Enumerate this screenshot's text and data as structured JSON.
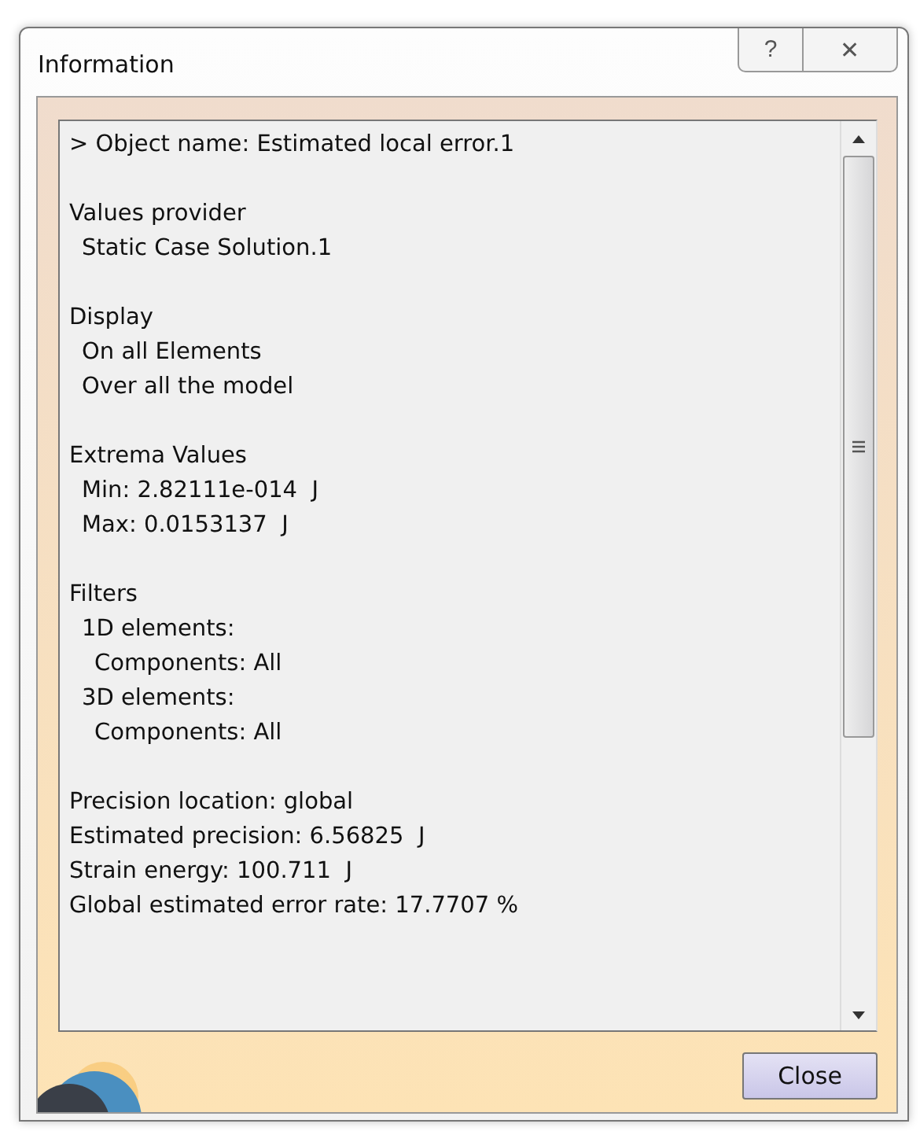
{
  "window": {
    "title": "Information",
    "title_buttons": [
      "?",
      "✕"
    ]
  },
  "groups": [
    [
      {
        "text": "> Object name: Estimated local error.1"
      }
    ],
    [
      {
        "text": "Values provider",
        "children": [
          {
            "text": "Static Case Solution.1"
          }
        ]
      }
    ],
    [
      {
        "text": "Display",
        "children": [
          {
            "text": "On all Elements"
          },
          {
            "text": "Over all the model"
          }
        ]
      }
    ],
    [
      {
        "text": "Extrema Values",
        "children": [
          {
            "text": "Min: 2.82111e-014  J"
          },
          {
            "text": "Max: 0.0153137  J"
          }
        ]
      }
    ],
    [
      {
        "text": "Filters",
        "children": [
          {
            "text": "1D elements:",
            "children": [
              {
                "text": "Components: All"
              }
            ]
          },
          {
            "text": "3D elements:",
            "children": [
              {
                "text": "Components: All"
              }
            ]
          }
        ]
      }
    ],
    [
      {
        "text": "Precision location: global"
      },
      {
        "text": "Estimated precision: 6.56825  J"
      },
      {
        "text": "Strain energy: 100.711  J"
      },
      {
        "text": "Global estimated error rate: 17.7707 %"
      }
    ]
  ],
  "buttons": [
    "Close"
  ]
}
